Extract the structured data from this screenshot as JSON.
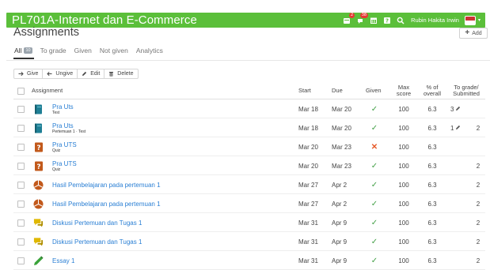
{
  "header": {
    "course_title": "PL701A-Internet dan E-Commerce",
    "notifications_badge": "2",
    "messages_badge": "38",
    "user_name": "Rubin Hakita Irwin"
  },
  "page": {
    "title": "Assignments",
    "add_label": "Add"
  },
  "tabs": [
    {
      "label": "All",
      "count": "10"
    },
    {
      "label": "To grade"
    },
    {
      "label": "Given"
    },
    {
      "label": "Not given"
    },
    {
      "label": "Analytics"
    }
  ],
  "toolbar": {
    "give": "Give",
    "ungive": "Ungive",
    "edit": "Edit",
    "delete": "Delete"
  },
  "columns": {
    "assignment": "Assignment",
    "start": "Start",
    "due": "Due",
    "given": "Given",
    "max_score_1": "Max",
    "max_score_2": "score",
    "pct_1": "% of",
    "pct_2": "overall",
    "tg_1": "To grade/",
    "tg_2": "Submitted"
  },
  "rows": [
    {
      "icon": "book-icon",
      "title": "Pra Uts",
      "sub": "Test",
      "start": "Mar 18",
      "due": "Mar 20",
      "given": "yes",
      "max": "100",
      "pct": "6.3",
      "to_grade": "3",
      "to_grade_pencil": true,
      "submitted": ""
    },
    {
      "icon": "book-icon",
      "title": "Pra Uts",
      "sub": "Pertemuan 1 · Test",
      "start": "Mar 18",
      "due": "Mar 20",
      "given": "yes",
      "max": "100",
      "pct": "6.3",
      "to_grade": "1",
      "to_grade_pencil": true,
      "submitted": "2"
    },
    {
      "icon": "quiz-icon",
      "title": "Pra UTS",
      "sub": "Quiz",
      "start": "Mar 20",
      "due": "Mar 23",
      "given": "no",
      "max": "100",
      "pct": "6.3",
      "to_grade": "",
      "to_grade_pencil": false,
      "submitted": ""
    },
    {
      "icon": "quiz-icon",
      "title": "Pra UTS",
      "sub": "Quiz",
      "start": "Mar 20",
      "due": "Mar 23",
      "given": "yes",
      "max": "100",
      "pct": "6.3",
      "to_grade": "",
      "to_grade_pencil": false,
      "submitted": "2"
    },
    {
      "icon": "pie-chart-icon",
      "title": "Hasil Pembelajaran pada pertemuan 1",
      "sub": "",
      "start": "Mar 27",
      "due": "Apr 2",
      "given": "yes",
      "max": "100",
      "pct": "6.3",
      "to_grade": "",
      "to_grade_pencil": false,
      "submitted": "2"
    },
    {
      "icon": "pie-chart-icon",
      "title": "Hasil Pembelajaran pada pertemuan 1",
      "sub": "",
      "start": "Mar 27",
      "due": "Apr 2",
      "given": "yes",
      "max": "100",
      "pct": "6.3",
      "to_grade": "",
      "to_grade_pencil": false,
      "submitted": "2"
    },
    {
      "icon": "discussion-icon",
      "title": "Diskusi Pertemuan dan Tugas 1",
      "sub": "",
      "start": "Mar 31",
      "due": "Apr 9",
      "given": "yes",
      "max": "100",
      "pct": "6.3",
      "to_grade": "",
      "to_grade_pencil": false,
      "submitted": "2"
    },
    {
      "icon": "discussion-icon",
      "title": "Diskusi Pertemuan dan Tugas 1",
      "sub": "",
      "start": "Mar 31",
      "due": "Apr 9",
      "given": "yes",
      "max": "100",
      "pct": "6.3",
      "to_grade": "",
      "to_grade_pencil": false,
      "submitted": "2"
    },
    {
      "icon": "essay-pencil-icon",
      "title": "Essay 1",
      "sub": "",
      "start": "Mar 31",
      "due": "Apr 9",
      "given": "yes",
      "max": "100",
      "pct": "6.3",
      "to_grade": "",
      "to_grade_pencil": false,
      "submitted": "2"
    }
  ],
  "colors": {
    "header_green": "#5bbf3a",
    "link_blue": "#2a7fd4",
    "check_green": "#43a047",
    "cross_orange": "#e65a2a",
    "book_teal": "#1f7f95",
    "quiz_orange": "#c2591b",
    "discussion_yellow": "#e0b800",
    "essay_green": "#3aa33a"
  }
}
